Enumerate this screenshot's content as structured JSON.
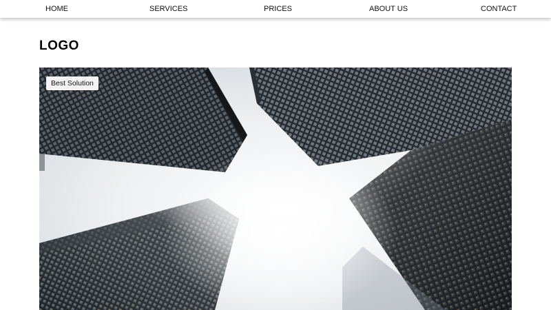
{
  "nav": {
    "items": [
      {
        "label": "HOME"
      },
      {
        "label": "SERVICES"
      },
      {
        "label": "PRICES"
      },
      {
        "label": "ABOUT US"
      },
      {
        "label": "CONTACT"
      }
    ]
  },
  "header": {
    "logo": "LOGO"
  },
  "hero": {
    "badge": "Best Solution",
    "image_subject": "skyscrapers-looking-up-in-fog"
  },
  "colors": {
    "nav_background": "#ffffff",
    "text": "#111111",
    "sky": "#e9ecef",
    "building_dark": "#1e2226",
    "building_mid": "#3a4046",
    "badge_background": "#f4f4f4"
  }
}
